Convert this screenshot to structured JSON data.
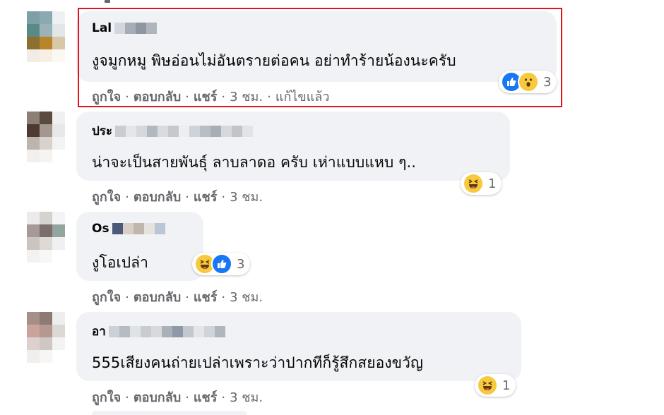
{
  "comments": [
    {
      "author": "Lal",
      "text": "งูจมูกหมู พิษอ่อนไม่อันตรายต่อคน อย่าทำร้ายน้องนะครับ",
      "actions": {
        "like": "ถูกใจ",
        "reply": "ตอบกลับ",
        "share": "แชร์",
        "time": "3 ชม.",
        "edited": "แก้ไขแล้ว"
      },
      "reactions": {
        "icons": [
          "like-icon",
          "wow-icon"
        ],
        "count": "3"
      }
    },
    {
      "author": "ประ",
      "text": "น่าจะเป็นสายพันธุ์ ลาบลาดอ ครับ เห่าแบบแหบ ๆ..",
      "actions": {
        "like": "ถูกใจ",
        "reply": "ตอบกลับ",
        "share": "แชร์",
        "time": "3 ชม."
      },
      "reactions": {
        "icons": [
          "haha-icon"
        ],
        "count": "1"
      }
    },
    {
      "author": "Os",
      "text": "งูโอเปล่า",
      "actions": {
        "like": "ถูกใจ",
        "reply": "ตอบกลับ",
        "share": "แชร์",
        "time": "3 ชม."
      },
      "reactions": {
        "icons": [
          "haha-icon",
          "like-icon"
        ],
        "count": "3"
      }
    },
    {
      "author": "อา",
      "text": "555เสียงคนถ่ายเปล่าเพราะว่าปากทีก็รู้สึกสยองขวัญ",
      "actions": {
        "like": "ถูกใจ",
        "reply": "ตอบกลับ",
        "share": "แชร์",
        "time": "3 ชม."
      },
      "reactions": {
        "icons": [
          "haha-icon"
        ],
        "count": "1"
      }
    }
  ],
  "colors": {
    "bubble": "#f0f2f5",
    "meta": "#65676b",
    "highlight": "#e0141e",
    "like": "#1877f2",
    "emoji": "#f7c93c"
  }
}
